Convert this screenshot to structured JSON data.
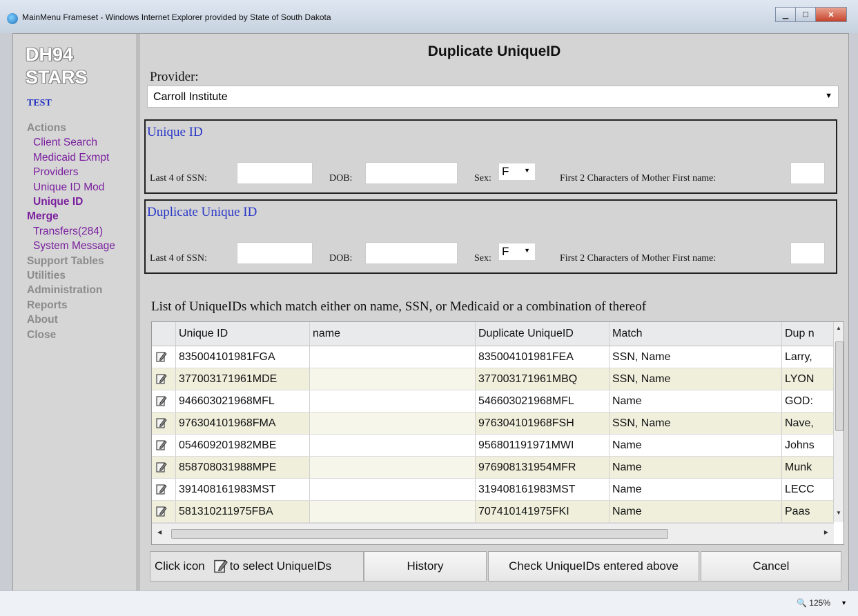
{
  "window": {
    "title": "MainMenu Frameset - Windows Internet Explorer provided by State of South Dakota"
  },
  "sidebar": {
    "logo_line1": "DH94",
    "logo_line2": "STARS",
    "env": "TEST",
    "items": [
      {
        "label": "Actions",
        "type": "head"
      },
      {
        "label": "Client Search",
        "type": "sub"
      },
      {
        "label": "Medicaid Exmpt",
        "type": "sub"
      },
      {
        "label": "Providers",
        "type": "sub"
      },
      {
        "label": "Unique ID Mod",
        "type": "sub"
      },
      {
        "label": "Unique ID",
        "type": "sub-active"
      },
      {
        "label": "Merge",
        "type": "head-active"
      },
      {
        "label": "Transfers(284)",
        "type": "sub"
      },
      {
        "label": "System Message",
        "type": "sub"
      },
      {
        "label": "Support Tables",
        "type": "head"
      },
      {
        "label": "Utilities",
        "type": "head"
      },
      {
        "label": "Administration",
        "type": "head"
      },
      {
        "label": "Reports",
        "type": "head"
      },
      {
        "label": "About",
        "type": "head"
      },
      {
        "label": "Close",
        "type": "head"
      }
    ]
  },
  "main": {
    "title": "Duplicate UniqueID",
    "provider_label": "Provider:",
    "provider_value": "Carroll Institute"
  },
  "unique_id": {
    "legend": "Unique ID",
    "ssn_label": "Last 4 of SSN:",
    "dob_label": "DOB:",
    "sex_label": "Sex:",
    "sex_value": "F",
    "mother_label": "First 2 Characters of Mother First name:"
  },
  "duplicate_unique_id": {
    "legend": "Duplicate Unique ID",
    "ssn_label": "Last 4 of SSN:",
    "dob_label": "DOB:",
    "sex_label": "Sex:",
    "sex_value": "F",
    "mother_label": "First 2 Characters of Mother First name:"
  },
  "list": {
    "title": "List of UniqueIDs which match either on name, SSN, or Medicaid or a combination of thereof",
    "columns": [
      "Unique ID",
      "name",
      "Duplicate UniqueID",
      "Match",
      "Dup n"
    ],
    "rows": [
      {
        "uid": "835004101981FGA",
        "name": "",
        "dup": "835004101981FEA",
        "match": "SSN, Name",
        "dupname": "Larry,"
      },
      {
        "uid": "377003171961MDE",
        "name": "",
        "dup": "377003171961MBQ",
        "match": "SSN, Name",
        "dupname": "LYON"
      },
      {
        "uid": "946603021968MFL",
        "name": "",
        "dup": "546603021968MFL",
        "match": "Name",
        "dupname": "GOD:"
      },
      {
        "uid": "976304101968FMA",
        "name": "",
        "dup": "976304101968FSH",
        "match": "SSN, Name",
        "dupname": "Nave,"
      },
      {
        "uid": "054609201982MBE",
        "name": "",
        "dup": "956801191971MWI",
        "match": "Name",
        "dupname": "Johns"
      },
      {
        "uid": "858708031988MPE",
        "name": "",
        "dup": "976908131954MFR",
        "match": "Name",
        "dupname": "Munk"
      },
      {
        "uid": "391408161983MST",
        "name": "",
        "dup": "319408161983MST",
        "match": "Name",
        "dupname": "LECC"
      },
      {
        "uid": "581310211975FBA",
        "name": "",
        "dup": "707410141975FKI",
        "match": "Name",
        "dupname": "Paas"
      }
    ]
  },
  "buttons": {
    "info_prefix": "Click icon",
    "info_suffix": "to select UniqueIDs",
    "history": "History",
    "check": "Check UniqueIDs entered above",
    "cancel": "Cancel"
  },
  "status": {
    "zoom": "125%"
  }
}
